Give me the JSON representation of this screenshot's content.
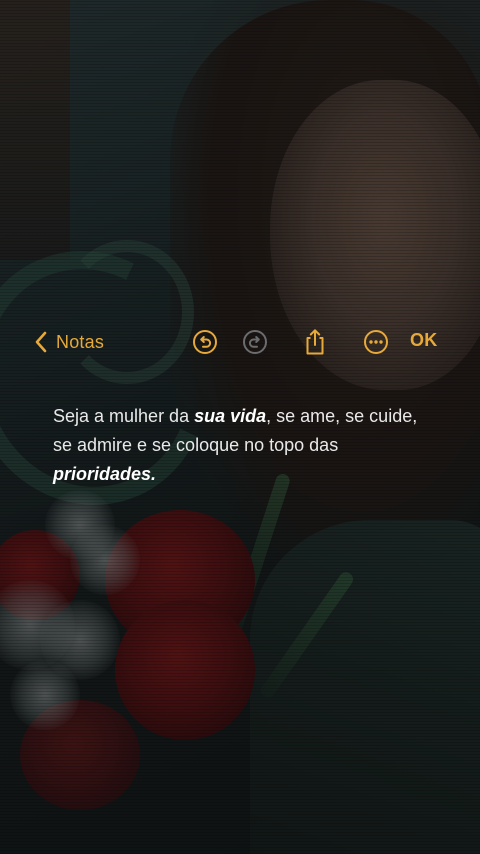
{
  "toolbar": {
    "back_label": "Notas",
    "ok_label": "OK",
    "accent_color": "#e6a93a",
    "icons": [
      "chevron-left-icon",
      "undo-icon",
      "redo-icon",
      "share-icon",
      "more-icon"
    ]
  },
  "note": {
    "line1_before": "Seja a mulher da ",
    "line1_emphasis": "sua vida",
    "line1_after": ", se ame, se cuide, se admire e se coloque no topo das ",
    "line2_emphasis": "prioridades."
  }
}
